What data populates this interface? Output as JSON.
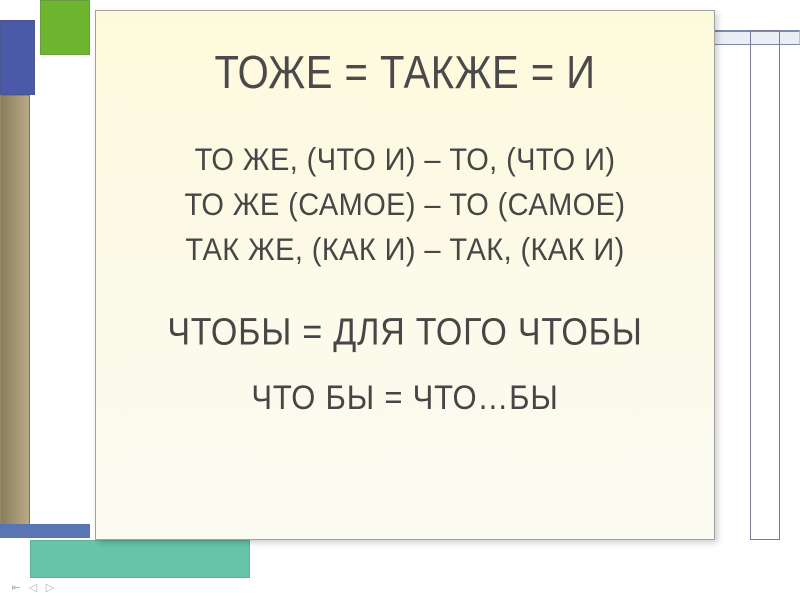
{
  "title": "ТОЖЕ = ТАКЖЕ = И",
  "rules": {
    "line1": "ТО  ЖЕ, (ЧТО И) – ТО, (ЧТО И)",
    "line2": "ТО  ЖЕ (САМОЕ) – ТО (САМОЕ)",
    "line3": "ТАК  ЖЕ, (КАК И) – ТАК, (КАК И)"
  },
  "subtitle": "ЧТОБЫ = ДЛЯ ТОГО ЧТОБЫ",
  "bottom": "ЧТО  БЫ = ЧТО…БЫ",
  "nav": {
    "first": "⇤",
    "prev": "◁",
    "next": "▷"
  }
}
